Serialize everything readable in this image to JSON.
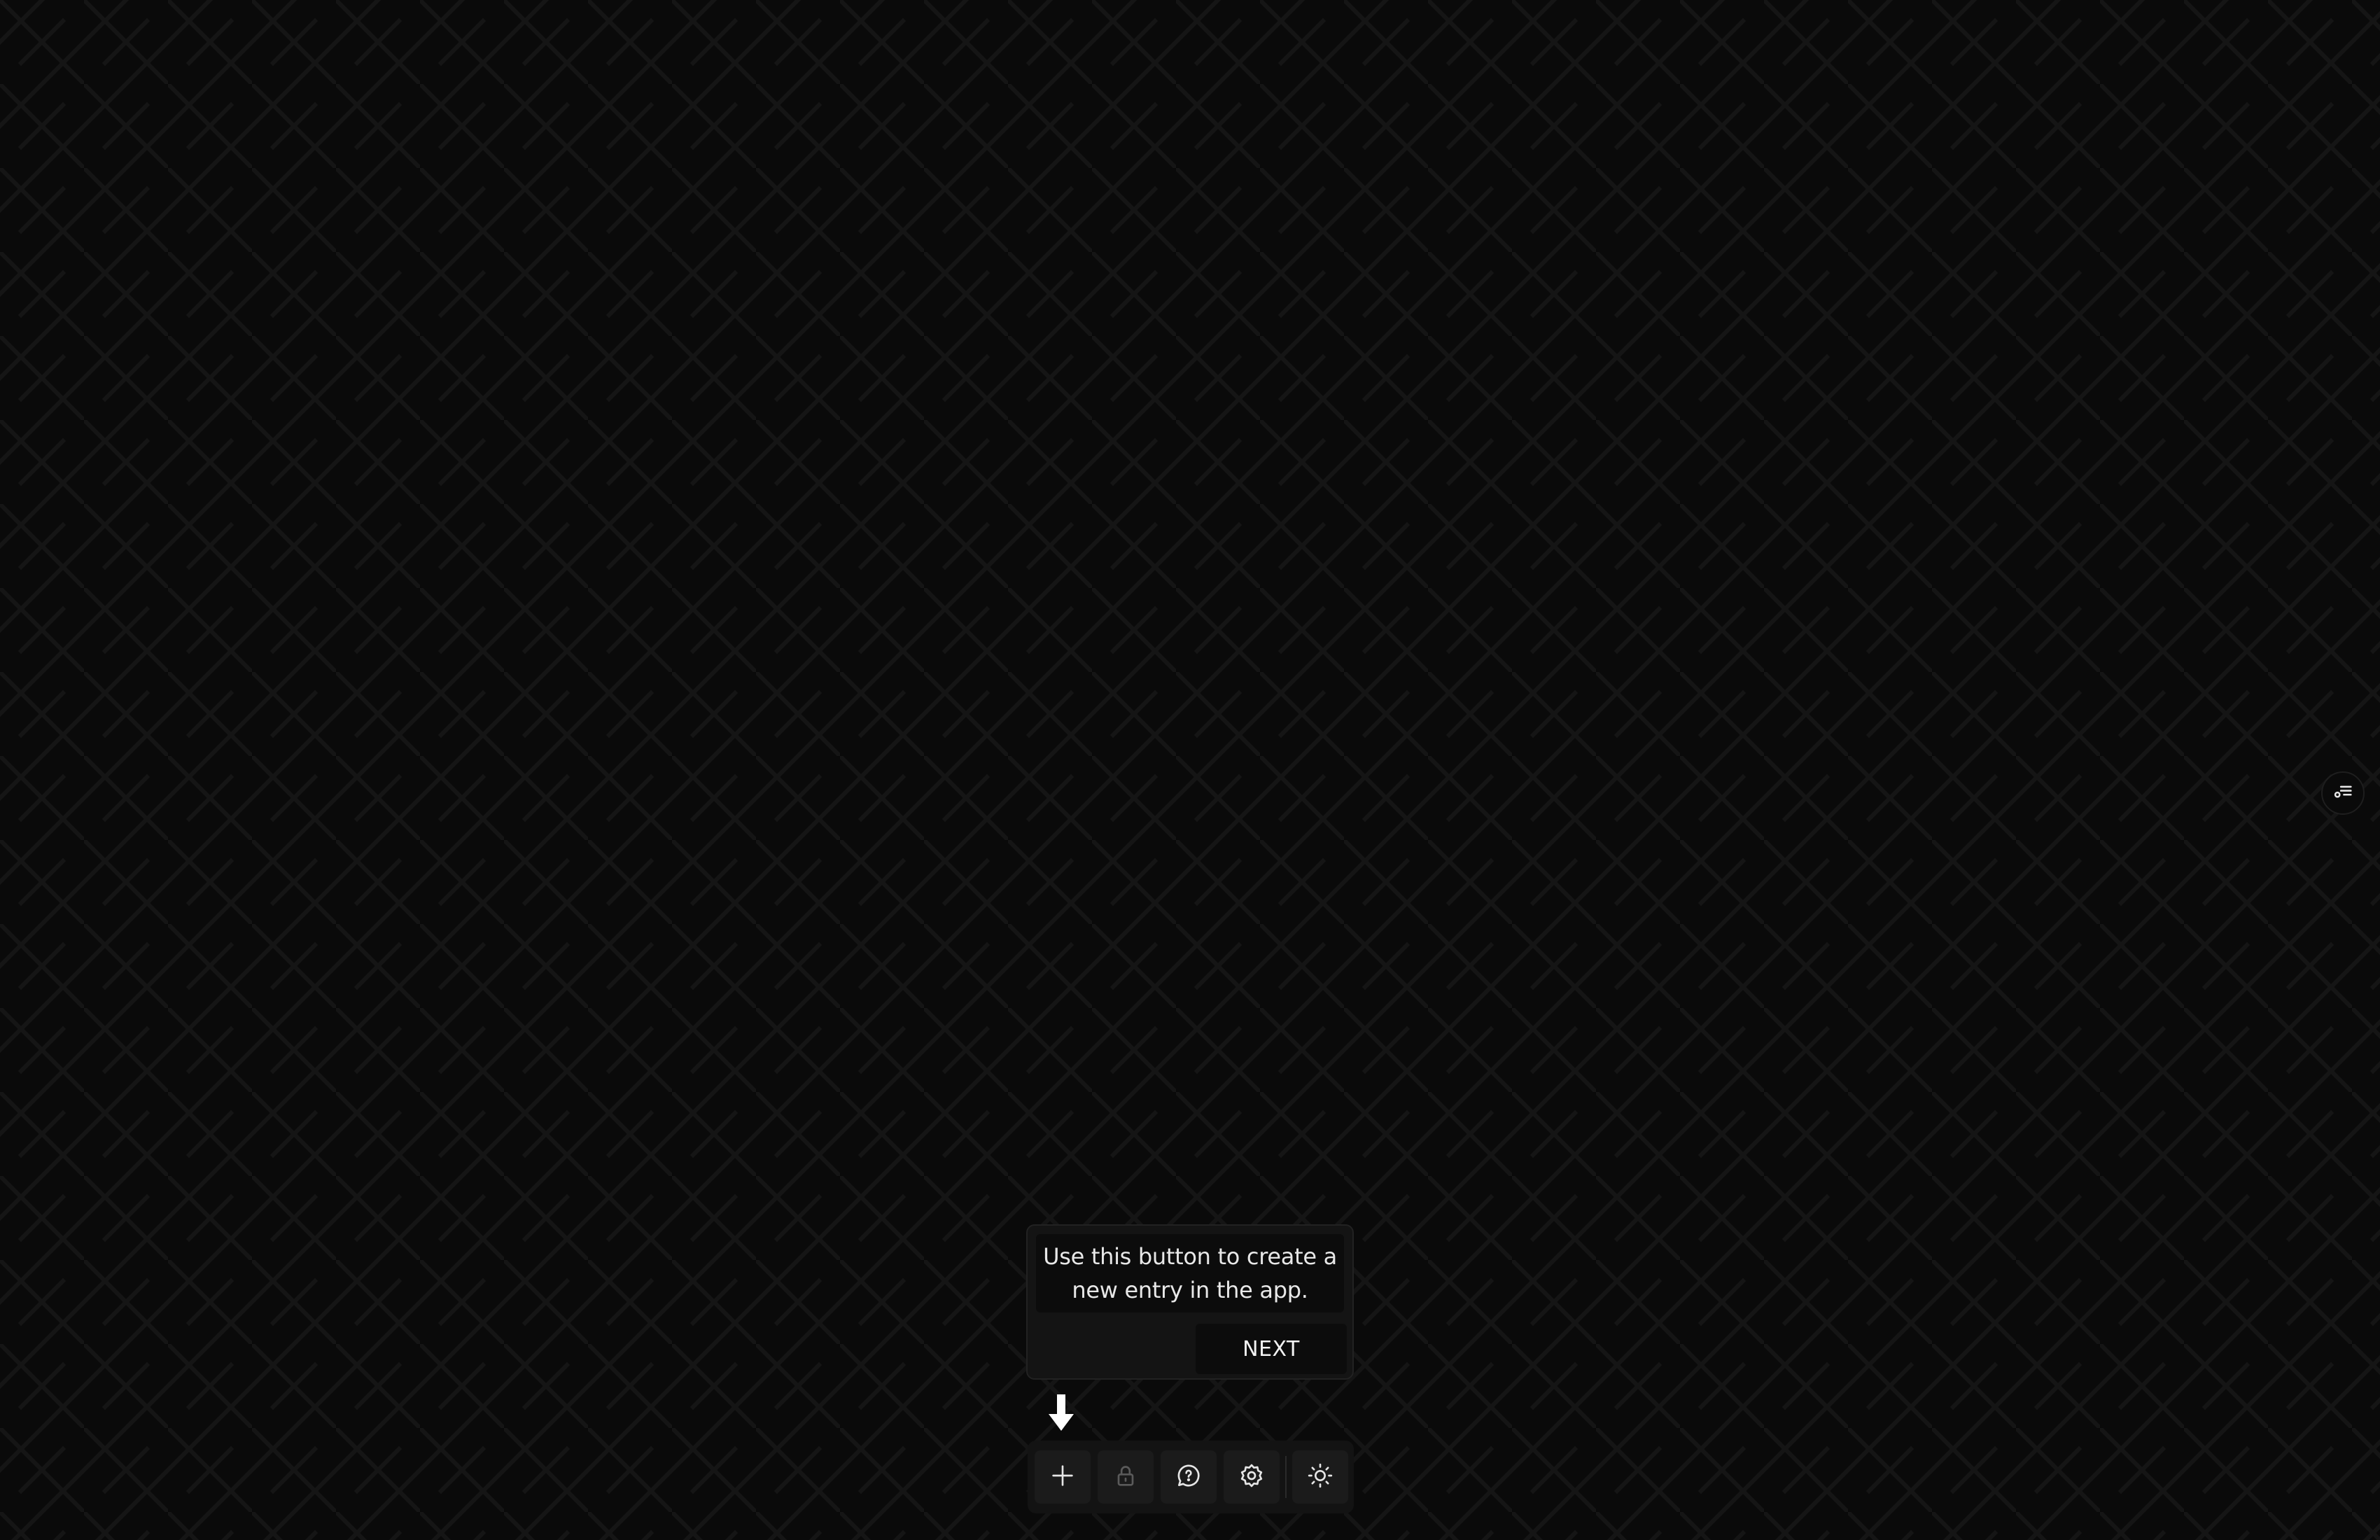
{
  "tour": {
    "message": "Use this button to create a new entry in the app.",
    "next_label": "NEXT"
  },
  "toolbar": {
    "buttons": [
      {
        "icon": "plus-icon",
        "label": ""
      },
      {
        "icon": "lock-icon",
        "label": ""
      },
      {
        "icon": "help-chat-icon",
        "label": ""
      },
      {
        "icon": "gear-icon",
        "label": ""
      },
      {
        "icon": "sun-icon",
        "label": ""
      }
    ]
  },
  "side_panel": {
    "icon": "filter-list-icon"
  },
  "colors": {
    "background": "#0a0a0a",
    "pattern_line": "#141414",
    "surface": "#141414",
    "button": "#1b1b1b",
    "text": "#e8e8e8"
  }
}
